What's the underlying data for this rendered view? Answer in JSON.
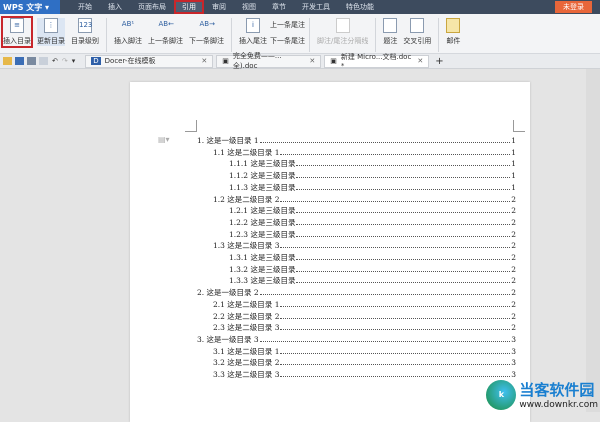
{
  "titlebar": {
    "app": "WPS 文字",
    "menus": [
      "开始",
      "插入",
      "页面布局",
      "引用",
      "审阅",
      "视图",
      "章节",
      "开发工具",
      "特色功能"
    ],
    "active": "引用",
    "login": "未登录"
  },
  "ribbon": {
    "insert_toc": "插入目录",
    "update_toc": "更新目录",
    "toc_level": "目录级别",
    "insert_footnote": "插入脚注",
    "prev_footnote": "上一条脚注",
    "next_footnote": "下一条脚注",
    "insert_endnote": "插入尾注",
    "prev_endnote": "上一条尾注",
    "next_endnote": "下一条尾注",
    "separator": "脚注/尾注分隔线",
    "caption": "题注",
    "cross_ref": "交叉引用",
    "mail": "邮件"
  },
  "tabs": [
    {
      "label": "Docer-在线模板"
    },
    {
      "label": "完全免费——...全).doc"
    },
    {
      "label": "新建 Micro...文档.doc *"
    }
  ],
  "toc": [
    {
      "level": 1,
      "text": "1. 这是一级目录 1",
      "page": "1"
    },
    {
      "level": 2,
      "text": "1.1 这是二级目录 1",
      "page": "1"
    },
    {
      "level": 3,
      "text": "1.1.1 这是三级目录",
      "page": "1"
    },
    {
      "level": 3,
      "text": "1.1.2 这是三级目录",
      "page": "1"
    },
    {
      "level": 3,
      "text": "1.1.3 这是三级目录",
      "page": "1"
    },
    {
      "level": 2,
      "text": "1.2 这是二级目录 2",
      "page": "2"
    },
    {
      "level": 3,
      "text": "1.2.1 这是三级目录",
      "page": "2"
    },
    {
      "level": 3,
      "text": "1.2.2 这是三级目录",
      "page": "2"
    },
    {
      "level": 3,
      "text": "1.2.3 这是三级目录",
      "page": "2"
    },
    {
      "level": 2,
      "text": "1.3 这是二级目录 3",
      "page": "2"
    },
    {
      "level": 3,
      "text": "1.3.1 这是三级目录",
      "page": "2"
    },
    {
      "level": 3,
      "text": "1.3.2 这是三级目录",
      "page": "2"
    },
    {
      "level": 3,
      "text": "1.3.3 这是三级目录",
      "page": "2"
    },
    {
      "level": 1,
      "text": "2. 这是一级目录 2",
      "page": "2"
    },
    {
      "level": 2,
      "text": "2.1 这是二级目录 1",
      "page": "2"
    },
    {
      "level": 2,
      "text": "2.2 这是二级目录 2",
      "page": "2"
    },
    {
      "level": 2,
      "text": "2.3 这是二级目录 3",
      "page": "2"
    },
    {
      "level": 1,
      "text": "3. 这是一级目录 3",
      "page": "3"
    },
    {
      "level": 2,
      "text": "3.1 这是二级目录 1",
      "page": "3"
    },
    {
      "level": 2,
      "text": "3.2 这是二级目录 2",
      "page": "3"
    },
    {
      "level": 2,
      "text": "3.3 这是二级目录 3",
      "page": "3"
    }
  ],
  "watermark": {
    "name": "当客软件园",
    "url": "www.downkr.com"
  }
}
